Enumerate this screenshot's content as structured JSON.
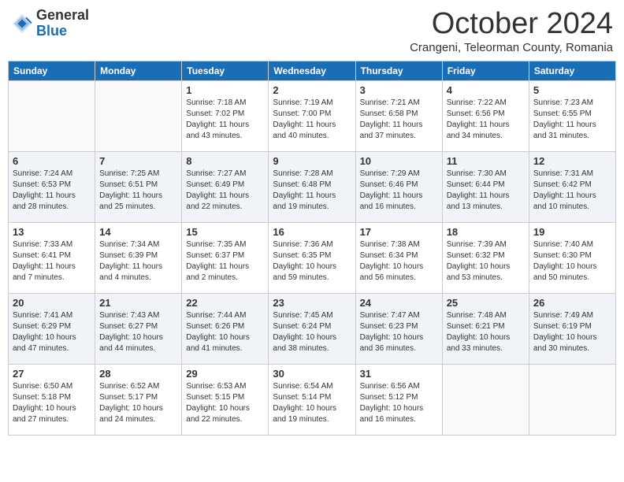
{
  "logo": {
    "general": "General",
    "blue": "Blue"
  },
  "header": {
    "month": "October 2024",
    "subtitle": "Crangeni, Teleorman County, Romania"
  },
  "weekdays": [
    "Sunday",
    "Monday",
    "Tuesday",
    "Wednesday",
    "Thursday",
    "Friday",
    "Saturday"
  ],
  "weeks": [
    [
      {
        "day": "",
        "info": ""
      },
      {
        "day": "",
        "info": ""
      },
      {
        "day": "1",
        "info": "Sunrise: 7:18 AM\nSunset: 7:02 PM\nDaylight: 11 hours and 43 minutes."
      },
      {
        "day": "2",
        "info": "Sunrise: 7:19 AM\nSunset: 7:00 PM\nDaylight: 11 hours and 40 minutes."
      },
      {
        "day": "3",
        "info": "Sunrise: 7:21 AM\nSunset: 6:58 PM\nDaylight: 11 hours and 37 minutes."
      },
      {
        "day": "4",
        "info": "Sunrise: 7:22 AM\nSunset: 6:56 PM\nDaylight: 11 hours and 34 minutes."
      },
      {
        "day": "5",
        "info": "Sunrise: 7:23 AM\nSunset: 6:55 PM\nDaylight: 11 hours and 31 minutes."
      }
    ],
    [
      {
        "day": "6",
        "info": "Sunrise: 7:24 AM\nSunset: 6:53 PM\nDaylight: 11 hours and 28 minutes."
      },
      {
        "day": "7",
        "info": "Sunrise: 7:25 AM\nSunset: 6:51 PM\nDaylight: 11 hours and 25 minutes."
      },
      {
        "day": "8",
        "info": "Sunrise: 7:27 AM\nSunset: 6:49 PM\nDaylight: 11 hours and 22 minutes."
      },
      {
        "day": "9",
        "info": "Sunrise: 7:28 AM\nSunset: 6:48 PM\nDaylight: 11 hours and 19 minutes."
      },
      {
        "day": "10",
        "info": "Sunrise: 7:29 AM\nSunset: 6:46 PM\nDaylight: 11 hours and 16 minutes."
      },
      {
        "day": "11",
        "info": "Sunrise: 7:30 AM\nSunset: 6:44 PM\nDaylight: 11 hours and 13 minutes."
      },
      {
        "day": "12",
        "info": "Sunrise: 7:31 AM\nSunset: 6:42 PM\nDaylight: 11 hours and 10 minutes."
      }
    ],
    [
      {
        "day": "13",
        "info": "Sunrise: 7:33 AM\nSunset: 6:41 PM\nDaylight: 11 hours and 7 minutes."
      },
      {
        "day": "14",
        "info": "Sunrise: 7:34 AM\nSunset: 6:39 PM\nDaylight: 11 hours and 4 minutes."
      },
      {
        "day": "15",
        "info": "Sunrise: 7:35 AM\nSunset: 6:37 PM\nDaylight: 11 hours and 2 minutes."
      },
      {
        "day": "16",
        "info": "Sunrise: 7:36 AM\nSunset: 6:35 PM\nDaylight: 10 hours and 59 minutes."
      },
      {
        "day": "17",
        "info": "Sunrise: 7:38 AM\nSunset: 6:34 PM\nDaylight: 10 hours and 56 minutes."
      },
      {
        "day": "18",
        "info": "Sunrise: 7:39 AM\nSunset: 6:32 PM\nDaylight: 10 hours and 53 minutes."
      },
      {
        "day": "19",
        "info": "Sunrise: 7:40 AM\nSunset: 6:30 PM\nDaylight: 10 hours and 50 minutes."
      }
    ],
    [
      {
        "day": "20",
        "info": "Sunrise: 7:41 AM\nSunset: 6:29 PM\nDaylight: 10 hours and 47 minutes."
      },
      {
        "day": "21",
        "info": "Sunrise: 7:43 AM\nSunset: 6:27 PM\nDaylight: 10 hours and 44 minutes."
      },
      {
        "day": "22",
        "info": "Sunrise: 7:44 AM\nSunset: 6:26 PM\nDaylight: 10 hours and 41 minutes."
      },
      {
        "day": "23",
        "info": "Sunrise: 7:45 AM\nSunset: 6:24 PM\nDaylight: 10 hours and 38 minutes."
      },
      {
        "day": "24",
        "info": "Sunrise: 7:47 AM\nSunset: 6:23 PM\nDaylight: 10 hours and 36 minutes."
      },
      {
        "day": "25",
        "info": "Sunrise: 7:48 AM\nSunset: 6:21 PM\nDaylight: 10 hours and 33 minutes."
      },
      {
        "day": "26",
        "info": "Sunrise: 7:49 AM\nSunset: 6:19 PM\nDaylight: 10 hours and 30 minutes."
      }
    ],
    [
      {
        "day": "27",
        "info": "Sunrise: 6:50 AM\nSunset: 5:18 PM\nDaylight: 10 hours and 27 minutes."
      },
      {
        "day": "28",
        "info": "Sunrise: 6:52 AM\nSunset: 5:17 PM\nDaylight: 10 hours and 24 minutes."
      },
      {
        "day": "29",
        "info": "Sunrise: 6:53 AM\nSunset: 5:15 PM\nDaylight: 10 hours and 22 minutes."
      },
      {
        "day": "30",
        "info": "Sunrise: 6:54 AM\nSunset: 5:14 PM\nDaylight: 10 hours and 19 minutes."
      },
      {
        "day": "31",
        "info": "Sunrise: 6:56 AM\nSunset: 5:12 PM\nDaylight: 10 hours and 16 minutes."
      },
      {
        "day": "",
        "info": ""
      },
      {
        "day": "",
        "info": ""
      }
    ]
  ]
}
